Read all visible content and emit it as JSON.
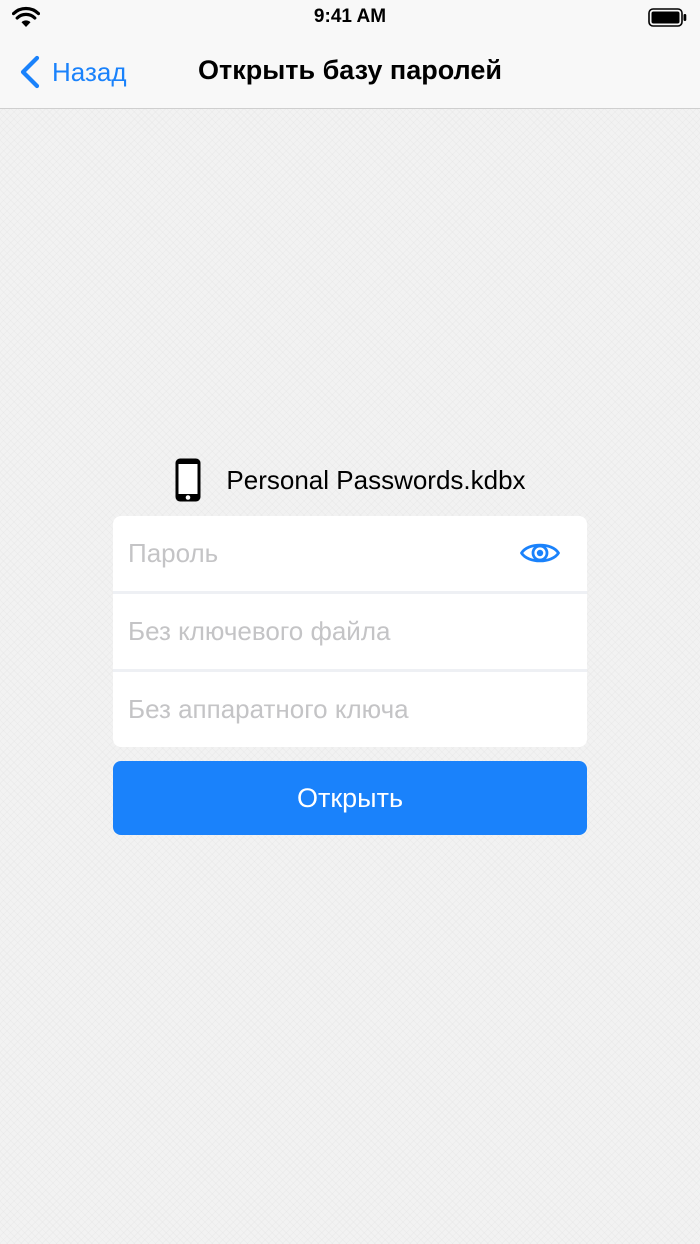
{
  "status_bar": {
    "time": "9:41 AM",
    "icons": [
      "wifi-icon",
      "battery-icon"
    ]
  },
  "nav": {
    "back_label": "Назад",
    "title": "Открыть базу паролей",
    "back_icon": "chevron-left-icon"
  },
  "database": {
    "file_name": "Personal Passwords.kdbx",
    "icon": "phone-icon"
  },
  "form": {
    "password_placeholder": "Пароль",
    "password_toggle_icon": "eye-icon",
    "key_file_placeholder": "Без ключевого файла",
    "hardware_key_placeholder": "Без аппаратного ключа"
  },
  "open_button": {
    "label": "Открыть"
  },
  "colors": {
    "accent": "#1a82fb",
    "background": "#f2f2f2",
    "placeholder": "#c4c4c6"
  }
}
